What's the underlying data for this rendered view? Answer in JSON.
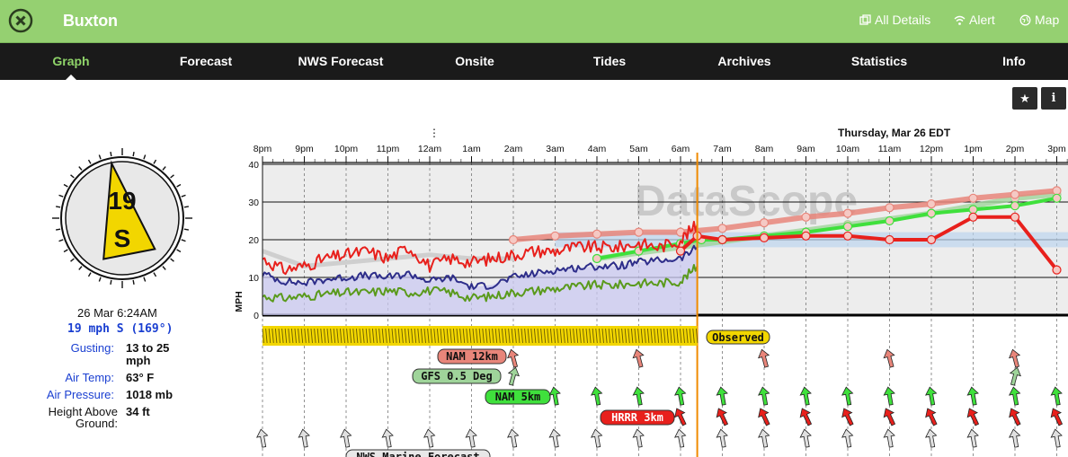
{
  "header": {
    "station": "Buxton",
    "links": [
      {
        "label": "All Details",
        "icon": "detail-icon"
      },
      {
        "label": "Alert",
        "icon": "wifi-icon"
      },
      {
        "label": "Map",
        "icon": "map-icon"
      }
    ]
  },
  "nav": {
    "tabs": [
      "Graph",
      "Forecast",
      "NWS Forecast",
      "Onsite",
      "Tides",
      "Archives",
      "Statistics",
      "Info"
    ],
    "active": "Graph"
  },
  "tools": {
    "star": "★",
    "info": "i"
  },
  "current": {
    "speed": "19",
    "direction": "S",
    "direction_degrees": 169,
    "timestamp": "26 Mar 6:24AM",
    "summary": "19 mph S (169°)",
    "gust_label": "Gusting:",
    "gust_value": "13 to 25",
    "gust_unit": "mph",
    "air_temp_label": "Air Temp:",
    "air_temp_value": "63° F",
    "pressure_label": "Air Pressure:",
    "pressure_value": "1018 mb",
    "height_label_1": "Height Above",
    "height_label_2": "Ground:",
    "height_value": "34 ft"
  },
  "colors": {
    "header": "#95d071",
    "nav": "#1a1a1a",
    "active_tab": "#8fd469",
    "observed": "#f2d600",
    "now_line": "#f08a00",
    "wind_avg": "#2e2e8a",
    "wind_lull": "#5a9a1c",
    "wind_gust": "#e8201c",
    "nam12": "#e8857a",
    "gfs": "#9fd49a",
    "nam5": "#3fe03c",
    "hrrr": "#e8201c"
  },
  "chart_data": {
    "type": "line",
    "day_label": "Thursday, Mar 26 EDT",
    "watermark": "DataScope",
    "ylabel": "MPH",
    "ylim": [
      0,
      40
    ],
    "yticks": [
      0,
      10,
      20,
      30,
      40
    ],
    "x_labels": [
      "8pm",
      "9pm",
      "10pm",
      "11pm",
      "12am",
      "1am",
      "2am",
      "3am",
      "4am",
      "5am",
      "6am",
      "7am",
      "8am",
      "9am",
      "10am",
      "11am",
      "12pm",
      "1pm",
      "2pm",
      "3pm"
    ],
    "x_hours": [
      20,
      21,
      22,
      23,
      24,
      25,
      26,
      27,
      28,
      29,
      30,
      31,
      32,
      33,
      34,
      35,
      36,
      37,
      38,
      39
    ],
    "now_hour": 30.4,
    "series": [
      {
        "key": "gust",
        "x": [
          20,
          20.5,
          21,
          21.5,
          22,
          22.5,
          23,
          23.5,
          24,
          24.5,
          25,
          25.5,
          26,
          26.5,
          27,
          27.5,
          28,
          28.5,
          29,
          29.5,
          30,
          30.4
        ],
        "y": [
          15,
          12,
          13,
          15,
          16,
          17,
          15,
          18,
          13,
          15,
          14,
          15,
          16,
          17,
          17,
          18,
          18,
          18,
          19,
          18,
          20,
          24
        ]
      },
      {
        "key": "avg",
        "x": [
          20,
          20.5,
          21,
          21.5,
          22,
          22.5,
          23,
          23.5,
          24,
          24.5,
          25,
          25.5,
          26,
          26.5,
          27,
          27.5,
          28,
          28.5,
          29,
          29.5,
          30,
          30.4
        ],
        "y": [
          11,
          9,
          8.5,
          9.5,
          10,
          10.5,
          10,
          11,
          9,
          10,
          7.5,
          8,
          10,
          11,
          12,
          12.5,
          13,
          13,
          14,
          14.5,
          15,
          18
        ]
      },
      {
        "key": "lull",
        "x": [
          20,
          20.5,
          21,
          21.5,
          22,
          22.5,
          23,
          23.5,
          24,
          24.5,
          25,
          25.5,
          26,
          26.5,
          27,
          27.5,
          28,
          28.5,
          29,
          29.5,
          30,
          30.4
        ],
        "y": [
          5,
          4.5,
          5,
          5.5,
          6,
          6,
          6.5,
          6,
          6.5,
          6,
          4.5,
          5,
          6,
          6.5,
          7,
          7.5,
          8,
          8,
          8.5,
          8.5,
          9,
          13
        ]
      },
      {
        "key": "nam12",
        "x": [
          26,
          27,
          28,
          29,
          30,
          31,
          32,
          33,
          34,
          35,
          36,
          37,
          38,
          39
        ],
        "y": [
          20,
          21,
          21.5,
          22,
          22,
          23,
          24.5,
          26,
          27,
          28.5,
          29.5,
          31,
          32,
          33
        ]
      },
      {
        "key": "nam5",
        "x": [
          28,
          29,
          30,
          30.5,
          31,
          32,
          33,
          34,
          35,
          36,
          37,
          38,
          39
        ],
        "y": [
          15,
          17,
          19,
          20,
          20,
          21,
          22,
          23.5,
          25,
          27,
          28,
          29,
          31
        ]
      },
      {
        "key": "gfs",
        "x": [
          28,
          30,
          32,
          34,
          36,
          38,
          39
        ],
        "y": [
          15,
          18,
          21,
          24,
          27,
          31,
          32
        ]
      },
      {
        "key": "hrrr",
        "x": [
          30,
          30.4,
          31,
          32,
          33,
          34,
          35,
          36,
          37,
          38,
          39
        ],
        "y": [
          17,
          21,
          20,
          20.5,
          21,
          21,
          20,
          20,
          26,
          26,
          12
        ]
      }
    ],
    "model_labels": [
      {
        "label": "NAM 12km",
        "key": "nam12"
      },
      {
        "label": "GFS 0.5 Deg",
        "key": "gfs"
      },
      {
        "label": "NAM 5km",
        "key": "nam5"
      },
      {
        "label": "HRRR 3km",
        "key": "hrrr"
      },
      {
        "label": "NWS Marine Forecast",
        "key": "nws"
      }
    ],
    "observed_label": "Observed"
  }
}
